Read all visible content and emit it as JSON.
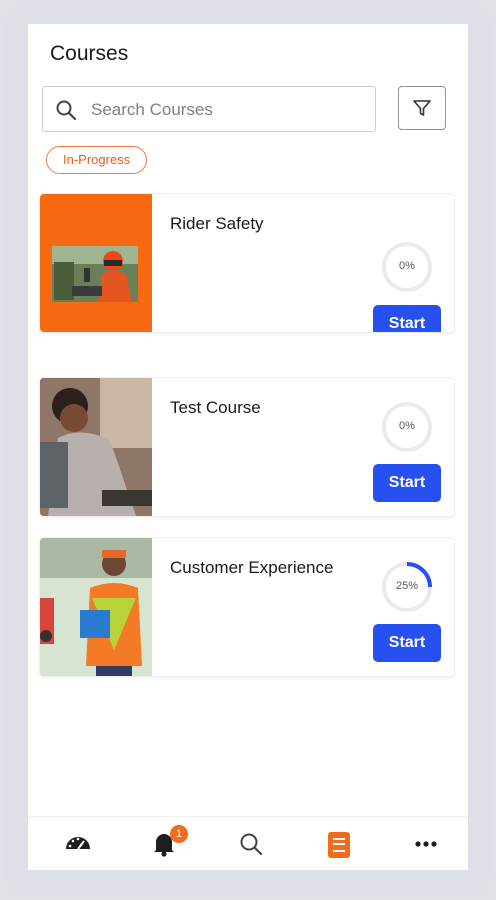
{
  "header": {
    "title": "Courses"
  },
  "search": {
    "placeholder": "Search Courses",
    "value": ""
  },
  "filter_chip": {
    "label": "In-Progress"
  },
  "courses": [
    {
      "title": "Rider Safety",
      "progress_label": "0%",
      "progress": 0,
      "button_label": "Start"
    },
    {
      "title": "Test Course",
      "progress_label": "0%",
      "progress": 0,
      "button_label": "Start"
    },
    {
      "title": "Customer Experience",
      "progress_label": "25%",
      "progress": 0.25,
      "button_label": "Start"
    }
  ],
  "bottom_nav": {
    "items": [
      "dashboard-icon",
      "notifications-icon",
      "search-icon",
      "courses-icon",
      "more-icon"
    ],
    "notifications_badge": "1",
    "active": "courses-icon"
  },
  "colors": {
    "accent": "#2650f0",
    "brand_orange": "#ef6c1c",
    "progress_ring": "#2650f0"
  }
}
